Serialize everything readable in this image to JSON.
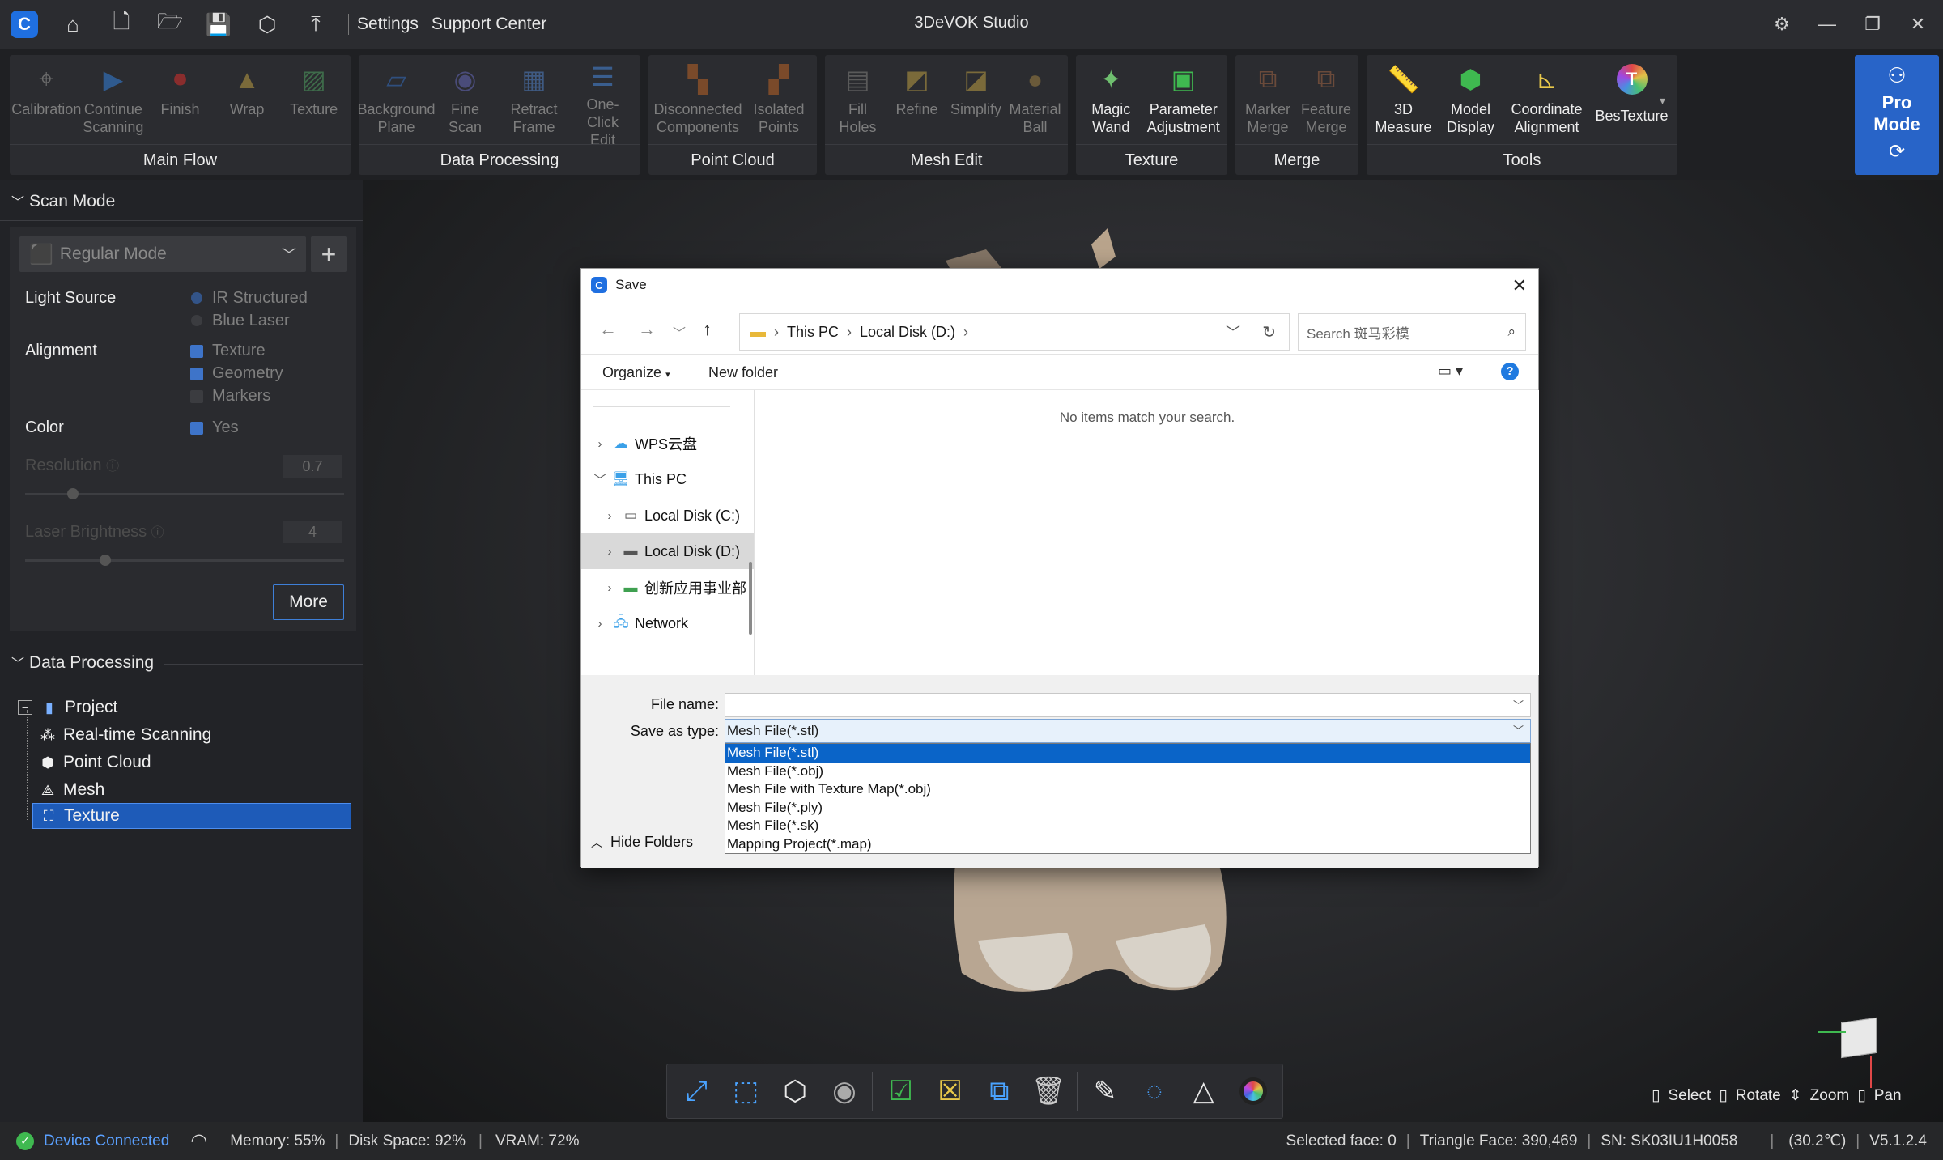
{
  "titlebar": {
    "links": [
      "Settings",
      "Support Center"
    ],
    "app_title": "3DeVOK Studio"
  },
  "ribbon": {
    "groups": [
      {
        "label": "Main Flow",
        "tools": [
          "Calibration",
          "Continue\nScanning",
          "Finish",
          "Wrap",
          "Texture"
        ]
      },
      {
        "label": "Data Processing",
        "tools": [
          "Background\nPlane",
          "Fine\nScan",
          "Retract\nFrame",
          "One-\nClick Edit"
        ]
      },
      {
        "label": "Point Cloud",
        "tools": [
          "Disconnected\nComponents",
          "Isolated\nPoints"
        ]
      },
      {
        "label": "Mesh Edit",
        "tools": [
          "Fill\nHoles",
          "Refine",
          "Simplify",
          "Material\nBall"
        ]
      },
      {
        "label": "Texture",
        "tools": [
          "Magic\nWand",
          "Parameter\nAdjustment"
        ]
      },
      {
        "label": "Merge",
        "tools": [
          "Marker\nMerge",
          "Feature\nMerge"
        ]
      },
      {
        "label": "Tools",
        "tools": [
          "3D\nMeasure",
          "Model\nDisplay",
          "Coordinate\nAlignment",
          "BesTexture"
        ]
      }
    ],
    "pro_mode": [
      "Pro",
      "Mode"
    ]
  },
  "left": {
    "scan_mode": {
      "header": "Scan Mode",
      "mode_select": "Regular Mode",
      "light_source_label": "Light Source",
      "light_source_options": [
        "IR Structured",
        "Blue Laser"
      ],
      "alignment_label": "Alignment",
      "alignment_options": [
        "Texture",
        "Geometry",
        "Markers"
      ],
      "color_label": "Color",
      "color_option": "Yes",
      "resolution_label": "Resolution",
      "resolution_value": "0.7",
      "resolution_level": 0.15,
      "laser_label": "Laser Brightness",
      "laser_value": "4",
      "laser_level": 0.25,
      "more_button": "More"
    },
    "data_processing": {
      "header": "Data Processing",
      "tree": [
        "Project",
        "Real-time Scanning",
        "Point Cloud",
        "Mesh",
        "Texture"
      ]
    }
  },
  "dialog": {
    "title": "Save",
    "breadcrumb": [
      "This PC",
      "Local Disk (D:)"
    ],
    "search_placeholder": "Search 斑马彩模",
    "organize": "Organize",
    "new_folder": "New folder",
    "nav_items": [
      "WPS云盘",
      "This PC",
      "Local Disk (C:)",
      "Local Disk (D:)",
      "创新应用事业部",
      "Network"
    ],
    "empty_message": "No items match your search.",
    "file_name_label": "File name:",
    "file_name_value": "",
    "save_type_label": "Save as type:",
    "save_type_value": "Mesh File(*.stl)",
    "type_options": [
      "Mesh File(*.stl)",
      "Mesh File(*.obj)",
      "Mesh File with Texture Map(*.obj)",
      "Mesh File(*.ply)",
      "Mesh File(*.sk)",
      "Mapping Project(*.map)"
    ],
    "hide_folders": "Hide Folders"
  },
  "mouse_help": [
    "Select",
    "Rotate",
    "Zoom",
    "Pan"
  ],
  "status": {
    "device": "Device Connected",
    "memory": "Memory:  55%",
    "disk": "Disk Space:  92%",
    "vram": "VRAM:  72%",
    "selected_face": "Selected face: 0",
    "triangle_face": "Triangle Face: 390,469",
    "sn": "SN: SK03IU1H0058",
    "temp": "(30.2℃)",
    "version": "V5.1.2.4"
  },
  "colors": {
    "accent": "#2864c8",
    "connected": "#3fb950",
    "selection": "#0a64c8"
  }
}
